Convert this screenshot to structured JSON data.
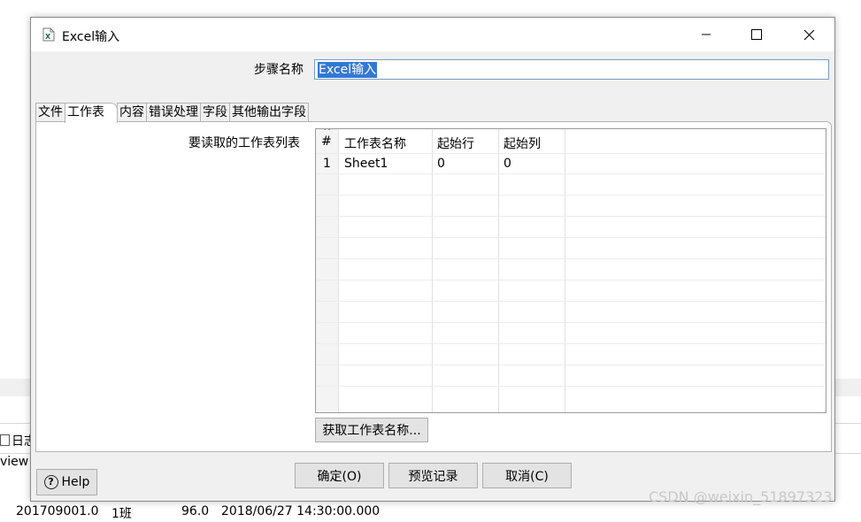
{
  "background": {
    "side_tab_label": "日志",
    "side_text": "view",
    "row_cells": [
      "201709001.0",
      "1班",
      "96.0",
      "2018/06/27 14:30:00.000"
    ]
  },
  "dialog": {
    "title": "Excel输入",
    "step_name_label": "步骤名称",
    "step_name_value": "Excel输入",
    "tabs": [
      "文件",
      "工作表",
      "内容",
      "错误处理",
      "字段",
      "其他输出字段"
    ],
    "active_tab_index": 1,
    "sheets_label": "要读取的工作表列表",
    "table": {
      "sort_glyph": "^",
      "headers": [
        "#",
        "工作表名称",
        "起始行",
        "起始列"
      ],
      "rows": [
        [
          "1",
          "Sheet1",
          "0",
          "0"
        ]
      ]
    },
    "get_sheets_button": "获取工作表名称...",
    "buttons": {
      "ok": "确定(O)",
      "preview": "预览记录",
      "cancel": "取消(C)",
      "help": "Help"
    }
  },
  "watermark": "CSDN @weixin_51897323",
  "icons": {
    "title_icon": "excel-file-icon",
    "minimize": "minimize-icon",
    "maximize": "maximize-icon",
    "close": "close-icon",
    "help": "help-icon"
  }
}
